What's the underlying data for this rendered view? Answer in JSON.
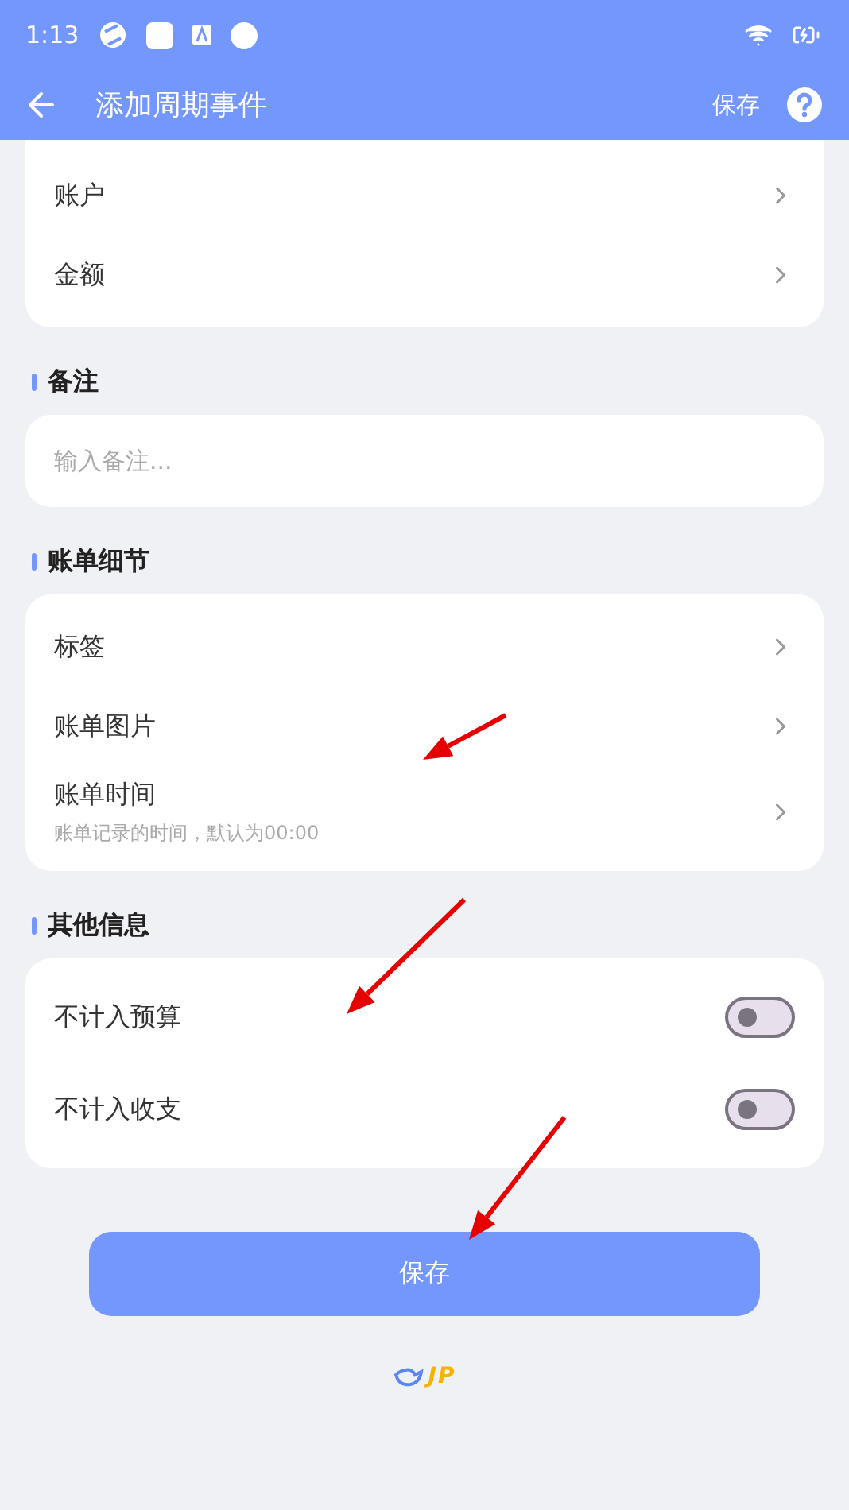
{
  "status_bar": {
    "time": "1:13"
  },
  "app_bar": {
    "title": "添加周期事件",
    "action": "保存"
  },
  "sections": [
    {
      "kind": "list",
      "rows": [
        {
          "label": "账户"
        },
        {
          "label": "金额"
        }
      ]
    },
    {
      "kind": "input",
      "title": "备注",
      "placeholder": "输入备注..."
    },
    {
      "kind": "list",
      "title": "账单细节",
      "rows": [
        {
          "label": "标签"
        },
        {
          "label": "账单图片"
        },
        {
          "label": "账单时间",
          "hint": "账单记录的时间，默认为00:00"
        }
      ]
    },
    {
      "kind": "toggles",
      "title": "其他信息",
      "rows": [
        {
          "label": "不计入预算",
          "on": false
        },
        {
          "label": "不计入收支",
          "on": false
        }
      ]
    }
  ],
  "save_button": "保存",
  "logo": {
    "text": "JP"
  }
}
